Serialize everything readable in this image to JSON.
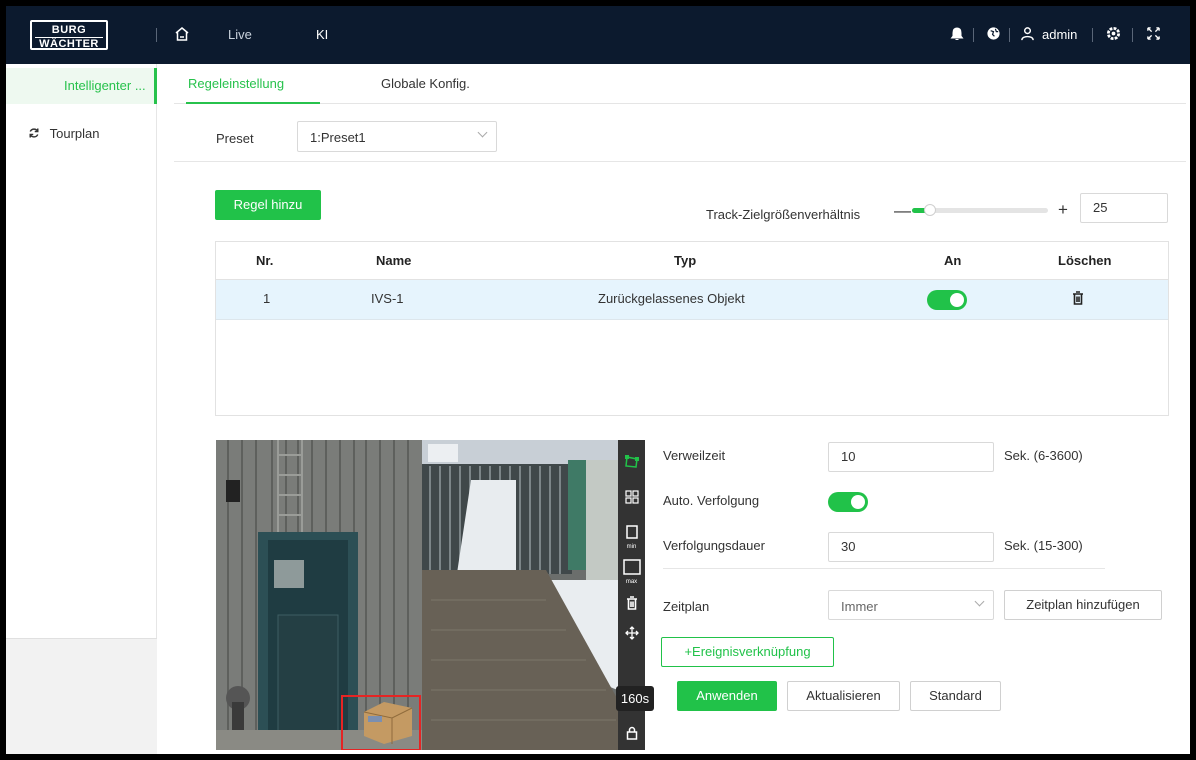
{
  "topbar": {
    "logo_line1": "BURG",
    "logo_line2": "WÄCHTER",
    "nav": {
      "live": "Live",
      "ki": "KI"
    },
    "user": "admin",
    "icons": [
      "home-icon",
      "bell-icon",
      "globe-icon",
      "user-icon",
      "settings-icon",
      "fullscreen-icon"
    ]
  },
  "sidebar": {
    "items": [
      {
        "label": "Intelligenter ...",
        "active": true
      },
      {
        "label": "Tourplan",
        "icon": "refresh-icon"
      }
    ]
  },
  "tabs": [
    {
      "label": "Regeleinstellung",
      "active": true
    },
    {
      "label": "Globale Konfig."
    }
  ],
  "preset": {
    "label": "Preset",
    "value": "1:Preset1"
  },
  "rules": {
    "add_label": "Regel hinzu",
    "track": {
      "label": "Track-Zielgrößenverhältnis",
      "value": "25",
      "min": "—",
      "max": "+",
      "slider_fraction": 0.13
    },
    "columns": [
      "Nr.",
      "Name",
      "Typ",
      "An",
      "Löschen"
    ],
    "rows": [
      {
        "nr": "1",
        "name": "IVS-1",
        "typ": "Zurückgelassenes Objekt",
        "on": true
      }
    ]
  },
  "video": {
    "badge": "160s",
    "tools": [
      "draw-region-icon",
      "grid-icon",
      "min-size-icon",
      "max-size-icon",
      "delete-icon",
      "move-icon",
      "lock-icon"
    ],
    "tool_labels": {
      "min": "min",
      "max": "max"
    }
  },
  "form": {
    "dwell": {
      "label": "Verweilzeit",
      "value": "10",
      "unit": "Sek. (6-3600)"
    },
    "auto_track": {
      "label": "Auto. Verfolgung",
      "on": true
    },
    "track_duration": {
      "label": "Verfolgungsdauer",
      "value": "30",
      "unit": "Sek. (15-300)"
    },
    "schedule": {
      "label": "Zeitplan",
      "value": "Immer",
      "add_label": "Zeitplan hinzufügen"
    },
    "event_link_label": "+Ereignisverknüpfung",
    "buttons": {
      "apply": "Anwenden",
      "refresh": "Aktualisieren",
      "default": "Standard"
    }
  },
  "colors": {
    "accent": "#21c249",
    "topbar": "#0c1a2e",
    "row_highlight": "#e6f4fd"
  }
}
